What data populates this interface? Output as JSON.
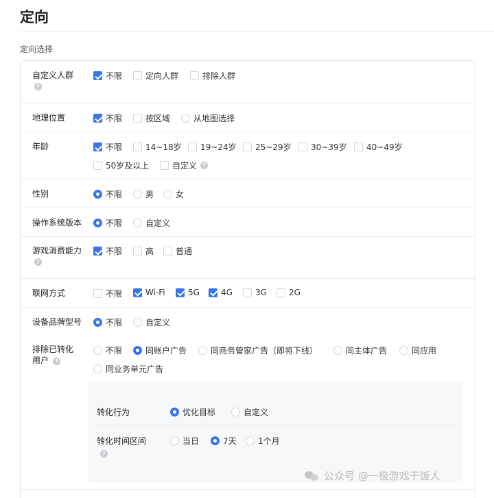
{
  "page": {
    "title": "定向",
    "section_label": "定向选择"
  },
  "help_glyph": "?",
  "rows": {
    "audience": {
      "label": "自定义人群",
      "options": [
        "不限",
        "定向人群",
        "排除人群"
      ]
    },
    "geo": {
      "label": "地理位置",
      "options": [
        "不限",
        "按区域",
        "从地图选择"
      ]
    },
    "age": {
      "label": "年龄",
      "options": [
        "不限",
        "14~18岁",
        "19~24岁",
        "25~29岁",
        "30~39岁",
        "40~49岁",
        "50岁及以上",
        "自定义"
      ]
    },
    "gender": {
      "label": "性别",
      "options": [
        "不限",
        "男",
        "女"
      ]
    },
    "os_version": {
      "label": "操作系统版本",
      "options": [
        "不限",
        "自定义"
      ]
    },
    "spending": {
      "label": "游戏消费能力",
      "options": [
        "不限",
        "高",
        "普通"
      ]
    },
    "network": {
      "label": "联网方式",
      "options": [
        "不限",
        "Wi-Fi",
        "5G",
        "4G",
        "3G",
        "2G"
      ]
    },
    "device_brand": {
      "label": "设备品牌型号",
      "options": [
        "不限",
        "自定义"
      ]
    },
    "exclude_converted": {
      "label_line1": "排除已转化",
      "label_line2": "用户",
      "options": [
        "不限",
        "同账户广告",
        "同商务管家广告（即将下线）",
        "同主体广告",
        "同应用",
        "同业务单元广告"
      ]
    }
  },
  "subpanel": {
    "conversion_behavior": {
      "label": "转化行为",
      "options": [
        "优化目标",
        "自定义"
      ]
    },
    "conversion_period": {
      "label": "转化时间区间",
      "options": [
        "当日",
        "7天",
        "1个月"
      ]
    }
  },
  "selected": {
    "audience": "不限",
    "geo": "不限",
    "age": "不限",
    "gender": "不限",
    "os_version": "不限",
    "spending": "不限",
    "network": [
      "Wi-Fi",
      "5G",
      "4G"
    ],
    "device_brand": "不限",
    "exclude_converted": "同账户广告",
    "conversion_behavior": "优化目标",
    "conversion_period": "7天"
  },
  "colors": {
    "accent": "#3875e8",
    "border": "#e4e6ea",
    "text": "#333333"
  },
  "watermark": {
    "text": "公众号 @一极游戏干饭人",
    "icon": "wechat-icon"
  }
}
